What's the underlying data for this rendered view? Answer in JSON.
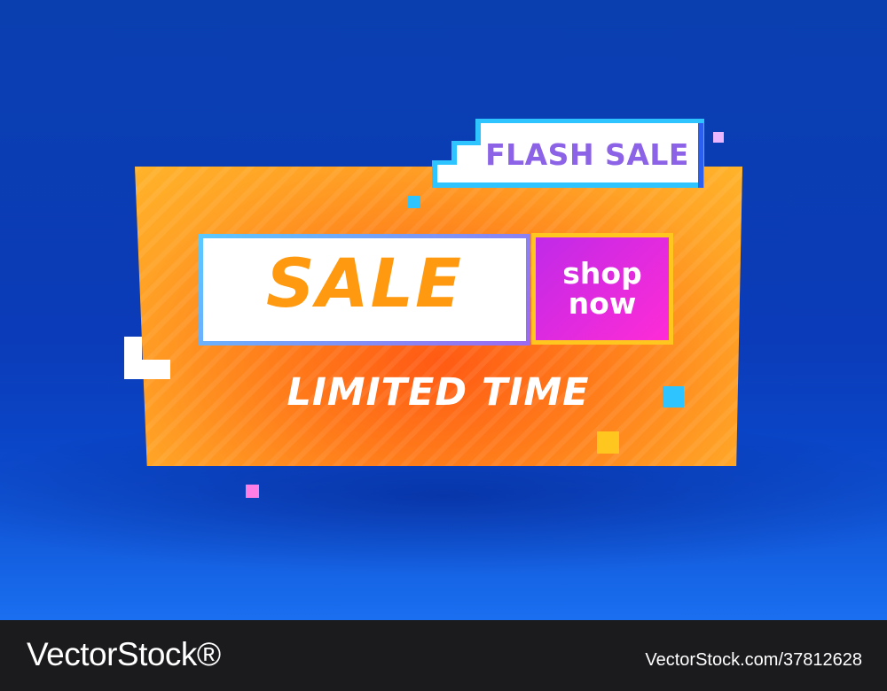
{
  "banner": {
    "tag_label": "FLASH SALE",
    "headline": "SALE",
    "cta_label": "shop now",
    "subline": "LIMITED TIME"
  },
  "watermark": {
    "brand": "VectorStock®",
    "image_ref": "VectorStock.com/37812628"
  },
  "colors": {
    "background": "#0b3bb8",
    "banner_orange": "#ff7a1a",
    "headline": "#ff9a10",
    "tag_text": "#8c62e6",
    "cta": "#d72ae6",
    "cta_border": "#ffc61f",
    "accent_cyan": "#2ec4ff"
  }
}
